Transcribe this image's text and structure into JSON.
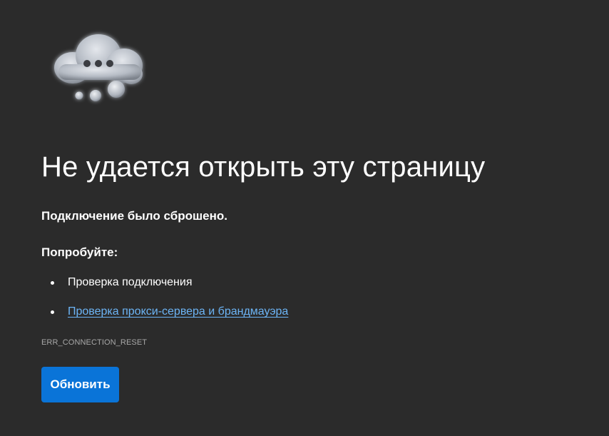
{
  "error": {
    "icon": "cloud-thinking-icon",
    "title": "Не удается открыть эту страницу",
    "subtitle": "Подключение было сброшено.",
    "try_heading": "Попробуйте:",
    "suggestions": [
      {
        "label": "Проверка подключения",
        "link": false
      },
      {
        "label": "Проверка прокси-сервера и брандмауэра",
        "link": true
      }
    ],
    "code": "ERR_CONNECTION_RESET",
    "refresh_label": "Обновить"
  },
  "colors": {
    "background": "#2b2b2b",
    "link": "#6cb4f5",
    "button": "#0a74d8",
    "muted_text": "#a8a8a8"
  }
}
